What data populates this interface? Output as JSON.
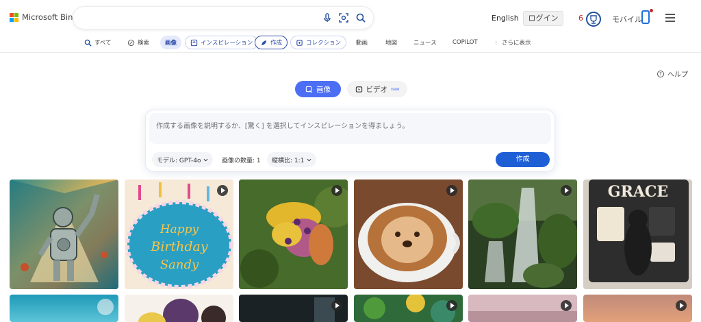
{
  "header": {
    "brand": "Microsoft Bing",
    "language": "English",
    "login": "ログイン",
    "points": "6",
    "mobile": "モバイル"
  },
  "tabs": [
    {
      "label": "すべて",
      "icon": "search-icon"
    },
    {
      "label": "検索",
      "icon": "copilot-icon"
    },
    {
      "label": "画像",
      "icon": ""
    },
    {
      "label": "インスピレーション",
      "icon": "inspiration-icon"
    },
    {
      "label": "作成",
      "icon": "create-icon"
    },
    {
      "label": "コレクション",
      "icon": "collection-icon"
    },
    {
      "label": "動画",
      "icon": ""
    },
    {
      "label": "地図",
      "icon": ""
    },
    {
      "label": "ニュース",
      "icon": ""
    },
    {
      "label": "COPILOT",
      "icon": ""
    },
    {
      "label": "さらに表示",
      "icon": "more-icon"
    }
  ],
  "help": "ヘルプ",
  "mode": {
    "image": "画像",
    "video": "ビデオ",
    "new_badge": "new"
  },
  "creator": {
    "placeholder": "作成する画像を説明するか、[驚く] を選択してインスピレーションを得ましょう。",
    "model_label": "モデル: GPT-4o",
    "count_label": "画像の数量: 1",
    "ratio_label": "縦横比: 1:1",
    "create_button": "作成"
  },
  "gallery": {
    "row1": [
      {
        "subject": "robot-artwork",
        "video": false
      },
      {
        "subject": "birthday-cake",
        "video": true,
        "caption": "Happy Birthday Sandy"
      },
      {
        "subject": "flower-bees",
        "video": true
      },
      {
        "subject": "otter-latte",
        "video": true
      },
      {
        "subject": "waterfall-forest",
        "video": true
      },
      {
        "subject": "dog-portrait",
        "video": false,
        "caption": "GRACE"
      }
    ],
    "row2": [
      {
        "subject": "sky",
        "video": false
      },
      {
        "subject": "cartoon-portrait",
        "video": false
      },
      {
        "subject": "dark-room",
        "video": true
      },
      {
        "subject": "jungle",
        "video": true
      },
      {
        "subject": "landscape",
        "video": true
      },
      {
        "subject": "sunset",
        "video": true
      }
    ]
  },
  "colors": {
    "accent": "#4c6ef5",
    "create_button": "#1f5fd6",
    "points": "#c62828"
  }
}
